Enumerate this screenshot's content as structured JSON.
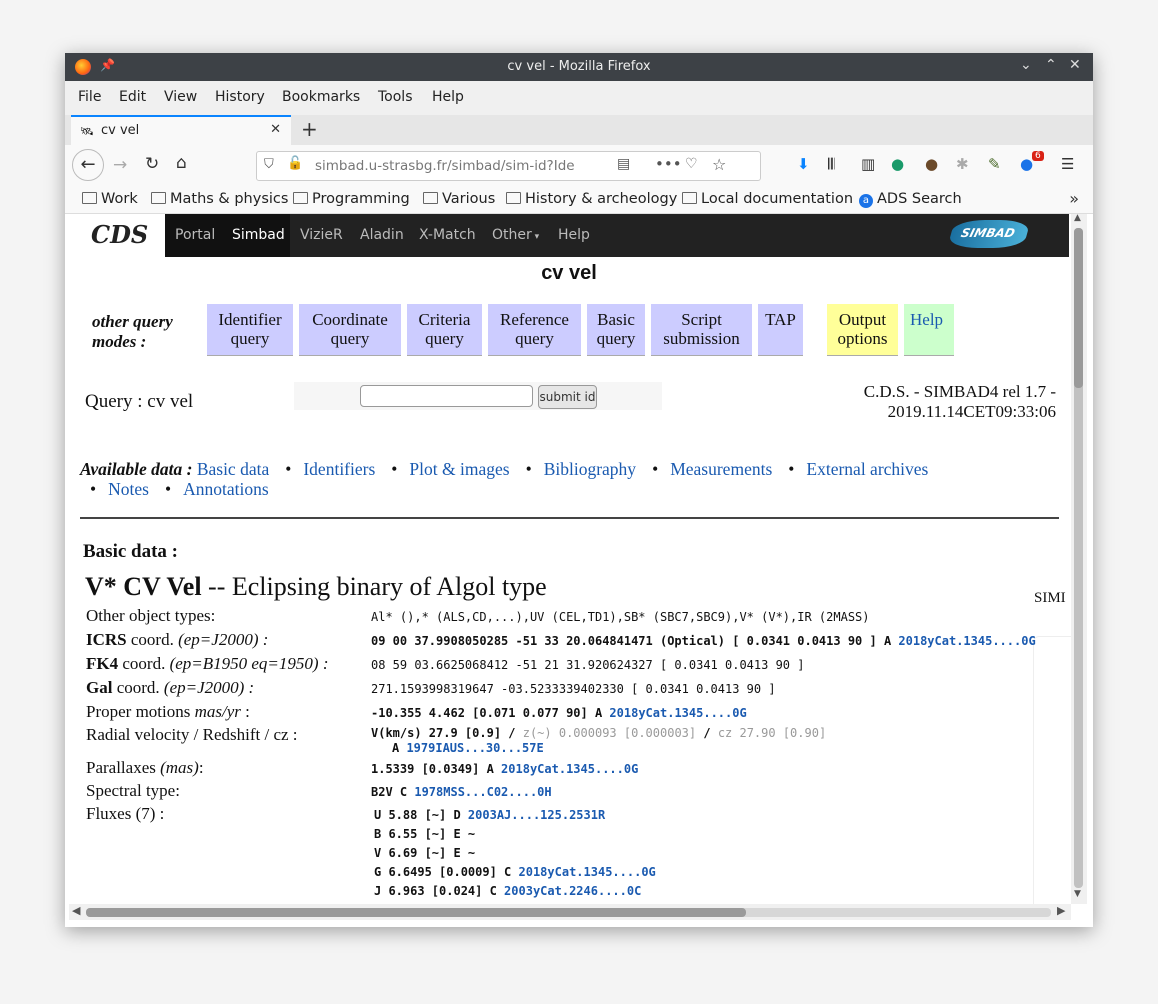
{
  "window": {
    "title": "cv vel - Mozilla Firefox"
  },
  "menu": [
    "File",
    "Edit",
    "View",
    "History",
    "Bookmarks",
    "Tools",
    "Help"
  ],
  "tab": {
    "label": "cv vel"
  },
  "url": {
    "display": "simbad.u-strasbg.fr/simbad/sim-id?Ide"
  },
  "toolbar": {
    "addon_badge": "6"
  },
  "bookmarks": [
    "Work",
    "Maths & physics",
    "Programming",
    "Various",
    "History & archeology",
    "Local documentation",
    "ADS Search"
  ],
  "cds": {
    "logo": "CDS",
    "nav": [
      "Portal",
      "Simbad",
      "VizieR",
      "Aladin",
      "X-Match",
      "Other",
      "Help"
    ],
    "simbad_logo": "SIMBAD"
  },
  "page": {
    "title": "cv vel",
    "other_query_modes": "other query modes :",
    "query_buttons": [
      {
        "label": "Identifier query"
      },
      {
        "label": "Coordinate query"
      },
      {
        "label": "Criteria query"
      },
      {
        "label": "Reference query"
      },
      {
        "label": "Basic query"
      },
      {
        "label": "Script submission"
      },
      {
        "label": "TAP"
      },
      {
        "label": "Output options"
      },
      {
        "label": "Help"
      }
    ],
    "query_label": "Query : cv vel",
    "query_input_value": "",
    "submit_label": "submit id",
    "release_line1": "C.D.S. - SIMBAD4 rel 1.7 -",
    "release_line2": "2019.11.14CET09:33:06",
    "available_label": "Available data :",
    "available_links": [
      "Basic data",
      "Identifiers",
      "Plot & images",
      "Bibliography",
      "Measurements",
      "External archives",
      "Notes",
      "Annotations"
    ],
    "basic_data_heading": "Basic data :",
    "object_name": "V* CV Vel",
    "object_type": "-- Eclipsing binary of Algol type",
    "side_label": "SIMI",
    "rows": {
      "other_types_label": "Other object types:",
      "other_types_value": "Al* (),* (ALS,CD,...),UV (CEL,TD1),SB* (SBC7,SBC9),V* (V*),IR (2MASS)",
      "icrs_label_bold": "ICRS",
      "icrs_label_rest": " coord. ",
      "icrs_label_italic": "(ep=J2000) :",
      "icrs_value": "09 00 37.9908050285 -51 33 20.064841471 (Optical) [ 0.0341 0.0413 90 ] A ",
      "icrs_ref": "2018yCat.1345....0G",
      "fk4_label_bold": "FK4",
      "fk4_label_rest": " coord. ",
      "fk4_label_italic": "(ep=B1950 eq=1950) :",
      "fk4_value": "08 59 03.6625068412 -51 21 31.920624327 [ 0.0341 0.0413 90 ]",
      "gal_label_bold": "Gal",
      "gal_label_rest": " coord. ",
      "gal_label_italic": "(ep=J2000) :",
      "gal_value": "271.1593998319647 -03.5233339402330 [ 0.0341 0.0413 90 ]",
      "pm_label": "Proper motions ",
      "pm_label_italic": "mas/yr",
      "pm_label_end": " :",
      "pm_value": "-10.355 4.462 [0.071 0.077 90] A ",
      "pm_ref": "2018yCat.1345....0G",
      "rv_label": "Radial velocity / Redshift / cz :",
      "rv_value": "V(km/s) 27.9 [0.9]",
      "rv_sep": " / ",
      "rv_z": "z(~) 0.000093 [0.000003]",
      "rv_cz": "cz 27.90 [0.90]",
      "rv_qual": "A ",
      "rv_ref": "1979IAUS...30...57E",
      "plx_label": "Parallaxes ",
      "plx_label_italic": "(mas)",
      "plx_label_end": ":",
      "plx_value": "1.5339 [0.0349] A ",
      "plx_ref": "2018yCat.1345....0G",
      "sp_label": "Spectral type:",
      "sp_value": "B2V C ",
      "sp_ref": "1978MSS...C02....0H",
      "flux_label": "Fluxes (7) :",
      "fluxes": [
        {
          "text": "U 5.88 [~] D ",
          "ref": "2003AJ....125.2531R"
        },
        {
          "text": "B 6.55 [~] E ~",
          "ref": ""
        },
        {
          "text": "V 6.69 [~] E ~",
          "ref": ""
        },
        {
          "text": "G 6.6495 [0.0009] C ",
          "ref": "2018yCat.1345....0G"
        },
        {
          "text": "J 6.963 [0.024] C ",
          "ref": "2003yCat.2246....0C"
        }
      ]
    }
  }
}
